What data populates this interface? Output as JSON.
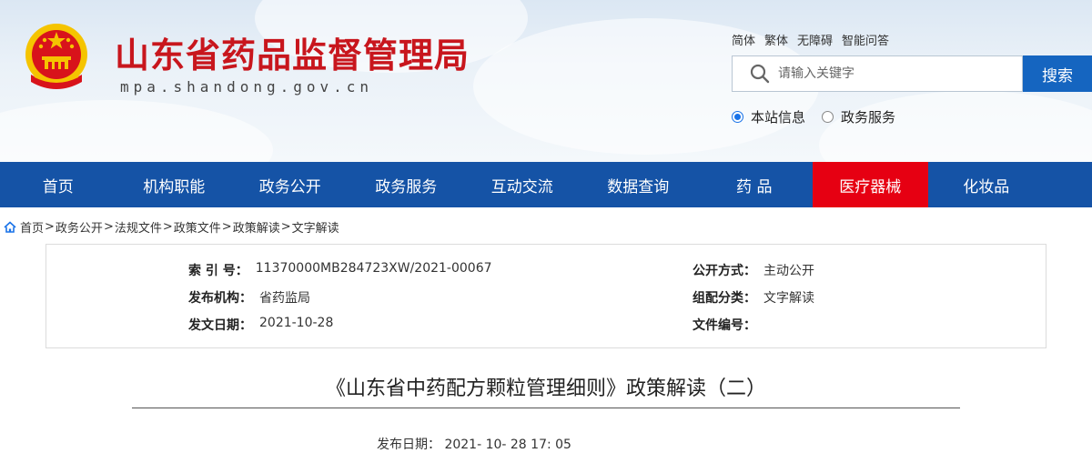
{
  "header": {
    "site_title": "山东省药品监督管理局",
    "site_domain": "mpa.shandong.gov.cn",
    "top_links": [
      "简体",
      "繁体",
      "无障碍",
      "智能问答"
    ],
    "search": {
      "placeholder": "请输入关键字",
      "button_label": "搜索"
    },
    "scope_options": [
      {
        "label": "本站信息",
        "checked": true
      },
      {
        "label": "政务服务",
        "checked": false
      }
    ],
    "emblem_icon": "national-emblem-icon"
  },
  "nav": {
    "items": [
      "首页",
      "机构职能",
      "政务公开",
      "政务服务",
      "互动交流",
      "数据查询",
      "药 品",
      "医疗器械",
      "化妆品"
    ],
    "active": "医疗器械",
    "colors": {
      "bar": "#1553a6",
      "active": "#e60012"
    }
  },
  "breadcrumb": {
    "home_icon": "home-icon",
    "items": [
      "首页",
      "政务公开",
      "法规文件",
      "政策文件",
      "政策解读",
      "文字解读"
    ],
    "separator": ">"
  },
  "meta": {
    "index_label": "索 引 号：",
    "index_value": "11370000MB284723XW/2021-00067",
    "publisher_label": "发布机构：",
    "publisher_value": "省药监局",
    "issue_date_label": "发文日期：",
    "issue_date_value": "2021-10-28",
    "disclosure_label": "公开方式：",
    "disclosure_value": "主动公开",
    "category_label": "组配分类：",
    "category_value": "文字解读",
    "doc_no_label": "文件编号：",
    "doc_no_value": ""
  },
  "article": {
    "title": "《山东省中药配方颗粒管理细则》政策解读（二）",
    "pub_date_label": "发布日期：",
    "pub_date_value": "2021- 10- 28 17: 05"
  },
  "colors": {
    "brand_red": "#c8161d",
    "search_blue": "#1565c0"
  }
}
